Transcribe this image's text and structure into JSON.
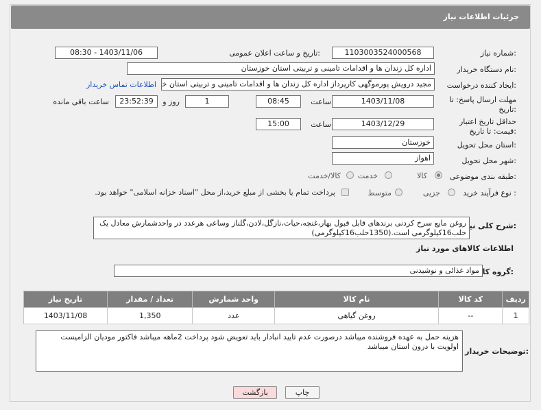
{
  "header": {
    "title": "جزئیات اطلاعات نیاز"
  },
  "fields": {
    "need_number_label": "شماره نیاز:",
    "need_number": "1103003524000568",
    "announce_label": "تاریخ و ساعت اعلان عمومی:",
    "announce_value": "1403/11/06 - 08:30",
    "buyer_org_label": "نام دستگاه خریدار:",
    "buyer_org": "اداره کل زندان ها و اقدامات تامینی و تربیتی استان خوزستان",
    "creator_label": "ایجاد کننده درخواست:",
    "creator": "مجید درویش پورموگهی کارپرداز اداره کل زندان ها و اقدامات تامینی و تربیتی استان خوزستان",
    "contact_link": "اطلاعات تماس خریدار",
    "deadline_label": "مهلت ارسال پاسخ: تا تاریخ:",
    "deadline_date": "1403/11/08",
    "time_label": "ساعت",
    "deadline_time": "08:45",
    "days_value": "1",
    "days_label": "روز و",
    "remaining_time": "23:52:39",
    "remaining_label": "ساعت باقی مانده",
    "validity_label": "حداقل تاریخ اعتبار قیمت: تا تاریخ:",
    "validity_date": "1403/12/29",
    "validity_time": "15:00",
    "province_label": "استان محل تحویل:",
    "province": "خوزستان",
    "city_label": "شهر محل تحویل:",
    "city": "اهواز",
    "category_label": "طبقه بندی موضوعی:",
    "category_options": [
      "کالا",
      "خدمت",
      "کالا/خدمت"
    ],
    "process_label": "نوع فرآیند خرید :",
    "process_options": [
      "جزیی",
      "متوسط"
    ],
    "payment_note": "پرداخت تمام یا بخشی از مبلغ خرید،از محل \"اسناد خزانه اسلامی\" خواهد بود."
  },
  "description": {
    "label": "شرح کلی نیاز:",
    "text": "روغن مایع سرخ کردنی برندهای قابل قبول بهار،غنچه،حیات،نازگل،لادن،گلناز وساعی هرعدد در واحدشمارش معادل یک حلب16کیلوگرمی است.(1350حلب16کیلوگرمی)"
  },
  "goods_section": {
    "title": "اطلاعات کالاهای مورد نیاز",
    "group_label": "گروه کالا:",
    "group_value": "مواد غذائی و نوشیدنی"
  },
  "table": {
    "headers": [
      "ردیف",
      "کد کالا",
      "نام کالا",
      "واحد شمارش",
      "تعداد / مقدار",
      "تاریخ نیاز"
    ],
    "rows": [
      [
        "1",
        "--",
        "روغن گیاهی",
        "عدد",
        "1,350",
        "1403/11/08"
      ]
    ]
  },
  "buyer_notes": {
    "label": "توضیحات خریدار:",
    "text": "هزینه حمل به عهده فروشنده میباشد درصورت عدم تایید انبادار باید تعویض شود پرداخت 2ماهه میباشد فاکتور مودیان الزامیست اولویت با درون استان میباشد"
  },
  "buttons": {
    "print": "چاپ",
    "back": "بازگشت"
  },
  "colors": {
    "header_bg": "#8a8a8a",
    "link": "#1a4fb8",
    "back_btn_bg": "#fadada"
  }
}
